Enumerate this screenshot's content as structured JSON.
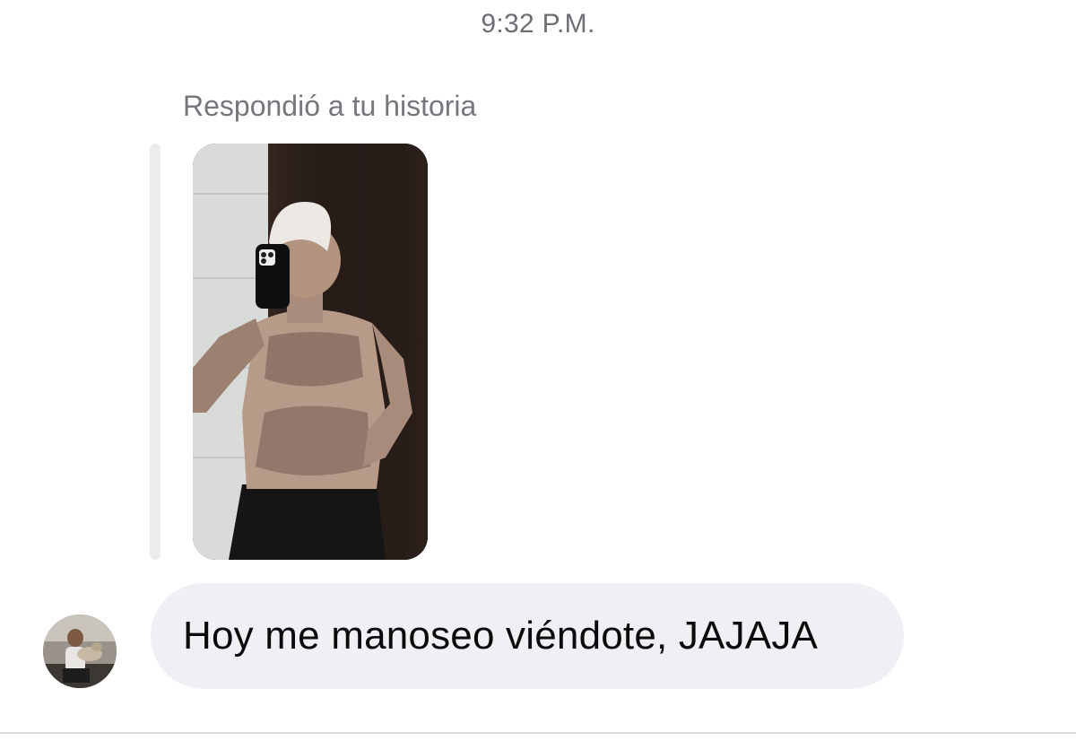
{
  "conversation": {
    "timestamp": "9:32 P.M.",
    "story_reply": {
      "context_label": "Respondió a tu historia",
      "thumbnail_icon": "story-photo"
    },
    "message": {
      "text": "Hoy me manoseo viéndote, JAJAJA",
      "sender_avatar_icon": "user-avatar"
    }
  },
  "colors": {
    "background": "#ffffff",
    "bubble": "#eff0f4",
    "meta_text": "#75777c",
    "message_text": "#0b0b0b",
    "reply_bar": "#ededef"
  }
}
